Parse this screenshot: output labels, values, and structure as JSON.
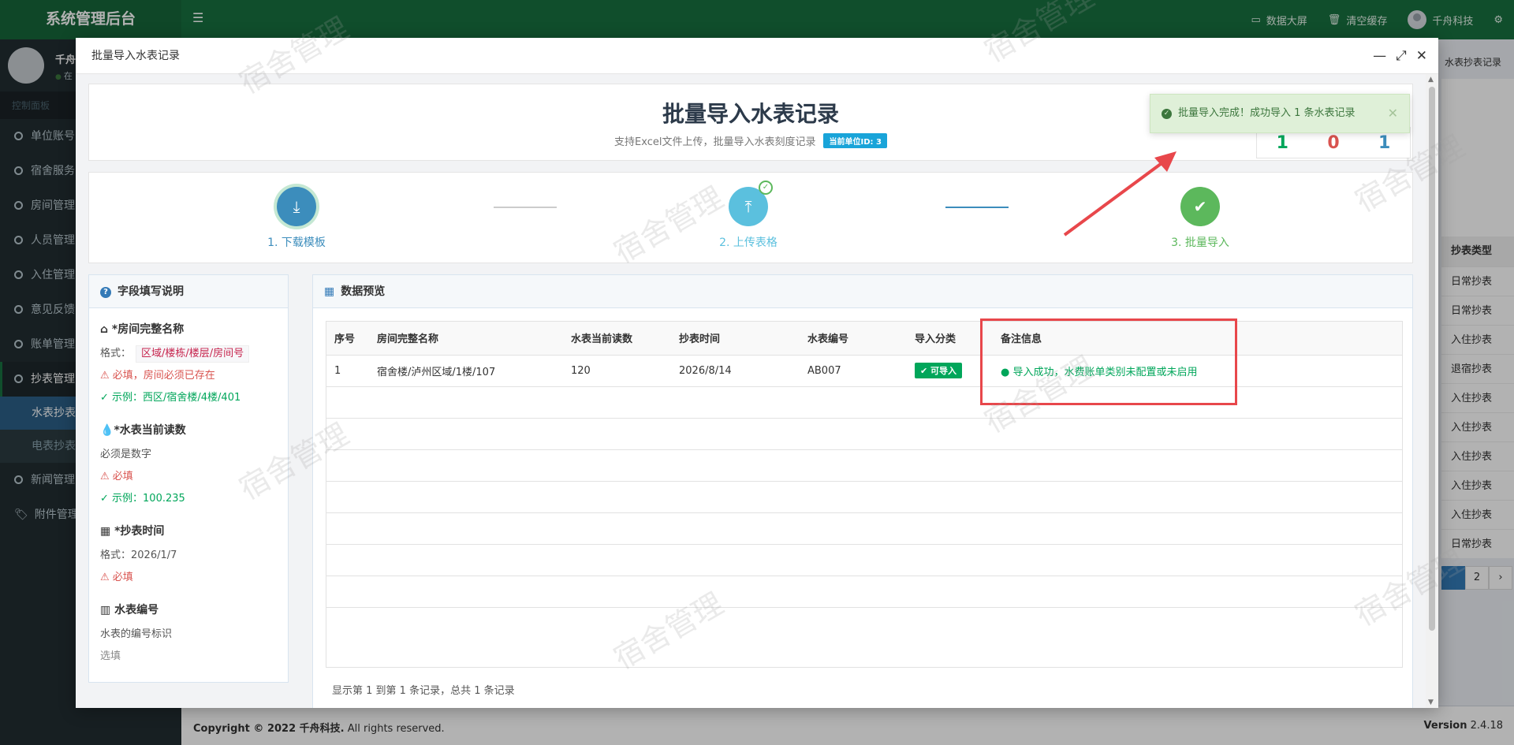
{
  "app": {
    "brand": "系统管理后台",
    "topnav": {
      "screen": "数据大屏",
      "clear_cache": "清空缓存",
      "user": "千舟科技"
    },
    "sidebar": {
      "user_name": "千舟",
      "user_status": "在",
      "section": "控制面板",
      "items": [
        "单位账号",
        "宿舍服务",
        "房间管理",
        "人员管理",
        "入住管理",
        "意见反馈",
        "账单管理",
        "抄表管理",
        "新闻管理",
        "附件管理"
      ],
      "sub_items": [
        "水表抄表",
        "电表抄表"
      ]
    },
    "right_tab": "水表抄表记录",
    "right_table": {
      "header": "抄表类型",
      "rows": [
        "日常抄表",
        "日常抄表",
        "入住抄表",
        "退宿抄表",
        "入住抄表",
        "入住抄表",
        "入住抄表",
        "入住抄表",
        "入住抄表",
        "日常抄表"
      ],
      "pager": [
        "2",
        "›"
      ]
    },
    "footer": {
      "copyright_prefix": "Copyright © 2022 ",
      "company": "千舟科技.",
      "rights": " All rights reserved.",
      "version_label": "Version",
      "version": "2.4.18"
    }
  },
  "modal": {
    "title": "批量导入水表记录",
    "header": {
      "title": "批量导入水表记录",
      "subtitle": "支持Excel文件上传，批量导入水表刻度记录",
      "badge": "当前单位ID: 3"
    },
    "stats": [
      "1",
      "0",
      "1"
    ],
    "steps": [
      {
        "label": "1. 下载模板",
        "color": "#3c8dbc"
      },
      {
        "label": "2. 上传表格",
        "color": "#5bc0de"
      },
      {
        "label": "3. 批量导入",
        "color": "#5cb85c"
      }
    ],
    "fields_panel": {
      "title": "字段填写说明",
      "sections": [
        {
          "title": "*房间完整名称",
          "lines": [
            "格式：",
            "区域/楼栋/楼层/房间号",
            "⚠ 必填，房间必须已存在",
            "✓ 示例：西区/宿舍楼/4楼/401"
          ]
        },
        {
          "title": "*水表当前读数",
          "lines": [
            "必须是数字",
            "⚠ 必填",
            "✓ 示例：100.235"
          ]
        },
        {
          "title": "*抄表时间",
          "lines": [
            "格式：2026/1/7",
            "⚠ 必填"
          ]
        },
        {
          "title": "水表编号",
          "lines": [
            "水表的编号标识",
            "选填"
          ]
        }
      ]
    },
    "preview": {
      "title": "数据预览",
      "columns": [
        "序号",
        "房间完整名称",
        "水表当前读数",
        "抄表时间",
        "水表编号",
        "导入分类",
        "备注信息"
      ],
      "rows": [
        {
          "index": "1",
          "room": "宿舍楼/泸州区域/1楼/107",
          "reading": "120",
          "time": "2026/8/14",
          "meter_no": "AB007",
          "category": "✔ 可导入",
          "note": "导入成功，水费账单类别未配置或未启用"
        }
      ],
      "footer": "显示第 1 到第 1 条记录，总共 1 条记录"
    }
  },
  "toast": {
    "message": "批量导入完成！成功导入 1 条水表记录"
  },
  "watermark": "宿舍管理",
  "colors": {
    "brand_green": "#18703f",
    "success": "#00a65a",
    "danger": "#d9534f",
    "highlight_red": "#e8474b"
  }
}
